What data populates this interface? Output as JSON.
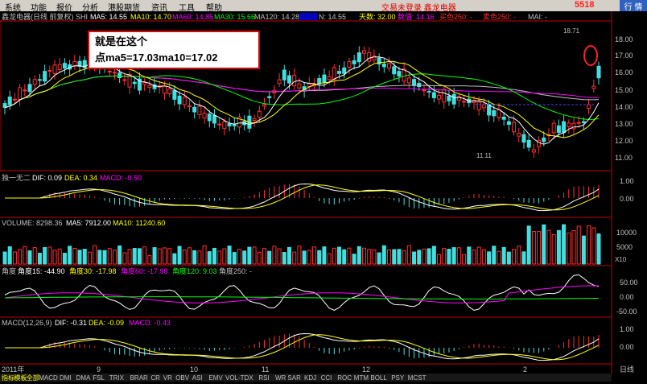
{
  "menu": {
    "items": [
      "系统",
      "功能",
      "报价",
      "分析",
      "港股期货",
      "资讯",
      "工具",
      "帮助"
    ],
    "status": "交易未登录  鑫龙电器",
    "watermark": "5518",
    "right_button": "行 情"
  },
  "colors": {
    "ma5": "#ffffff",
    "ma10": "#ffff00",
    "ma60": "#ff00ff",
    "ma30": "#00ff00",
    "ma120": "#c0c0c0",
    "up": "#ff3030",
    "down": "#40e0e0",
    "axis": "#c00000",
    "annotation_border": "#e00000"
  },
  "main_panel": {
    "title": "鑫龙电器(日线 前复权)",
    "code": "SHI",
    "ma5": "MA5: 14.55",
    "ma10": "MA10: 14.70",
    "ma60": "MA60: 14.85",
    "ma30": "MA30: 15.66",
    "ma120": "MA120: 14.28",
    "n_label": "N: 14.55",
    "days": "天数: 32.00",
    "count": "数值: 14.16",
    "buy1": "买色250: -",
    "buy2": "卖色250: -",
    "mai": "MAI: -",
    "y_ticks": [
      "18.00",
      "17.00",
      "16.00",
      "15.00",
      "14.00",
      "13.00",
      "12.00",
      "11.00"
    ],
    "high_label": "18.71",
    "low_label": "11.11"
  },
  "annotation": {
    "line1": "就是在这个",
    "line2": "点ma5=17.03ma10=17.02"
  },
  "indicator1": {
    "name": "独一无二",
    "dif": "DIF: 0.09",
    "dea": "DEA: 0.34",
    "macd": "MACD: -0.50",
    "y_ticks": [
      "1.00",
      "0.00"
    ]
  },
  "volume": {
    "vol": "VOLUME: 8298.36",
    "ma5": "MA5: 7912.00",
    "ma10": "MA10: 11240.60",
    "y_ticks": [
      "10000",
      "5000",
      "X10"
    ]
  },
  "angle": {
    "name": "角度",
    "a15": "角度15: -44.90",
    "a30": "角度30: -17.98",
    "a60": "角度60: -17.98",
    "a120": "角度120: 9.03",
    "a250": "角度250: -",
    "y_ticks": [
      "50.00",
      "0.00",
      "-50.00"
    ]
  },
  "macd": {
    "name": "MACD(12,26,9)",
    "dif": "DIF: -0.31",
    "dea": "DEA: -0.09",
    "macd": "MACD: -0.43",
    "y_ticks": [
      "1.00",
      "0.00"
    ]
  },
  "x_axis": {
    "labels": [
      "2011年",
      "9",
      "10",
      "11",
      "12",
      "2"
    ],
    "right_label": "日线"
  },
  "tabs": [
    "指标",
    "模板",
    "全部",
    "MACD",
    "DMI",
    "DMA",
    "FSL",
    "TRIX",
    "BRAR",
    "CR",
    "VR",
    "OBV",
    "ASI",
    "EMV",
    "VOL-TDX",
    "RSI",
    "WR",
    "SAR",
    "KDJ",
    "CCI",
    "ROC",
    "MTM",
    "BOLL",
    "PSY",
    "MCST"
  ]
}
